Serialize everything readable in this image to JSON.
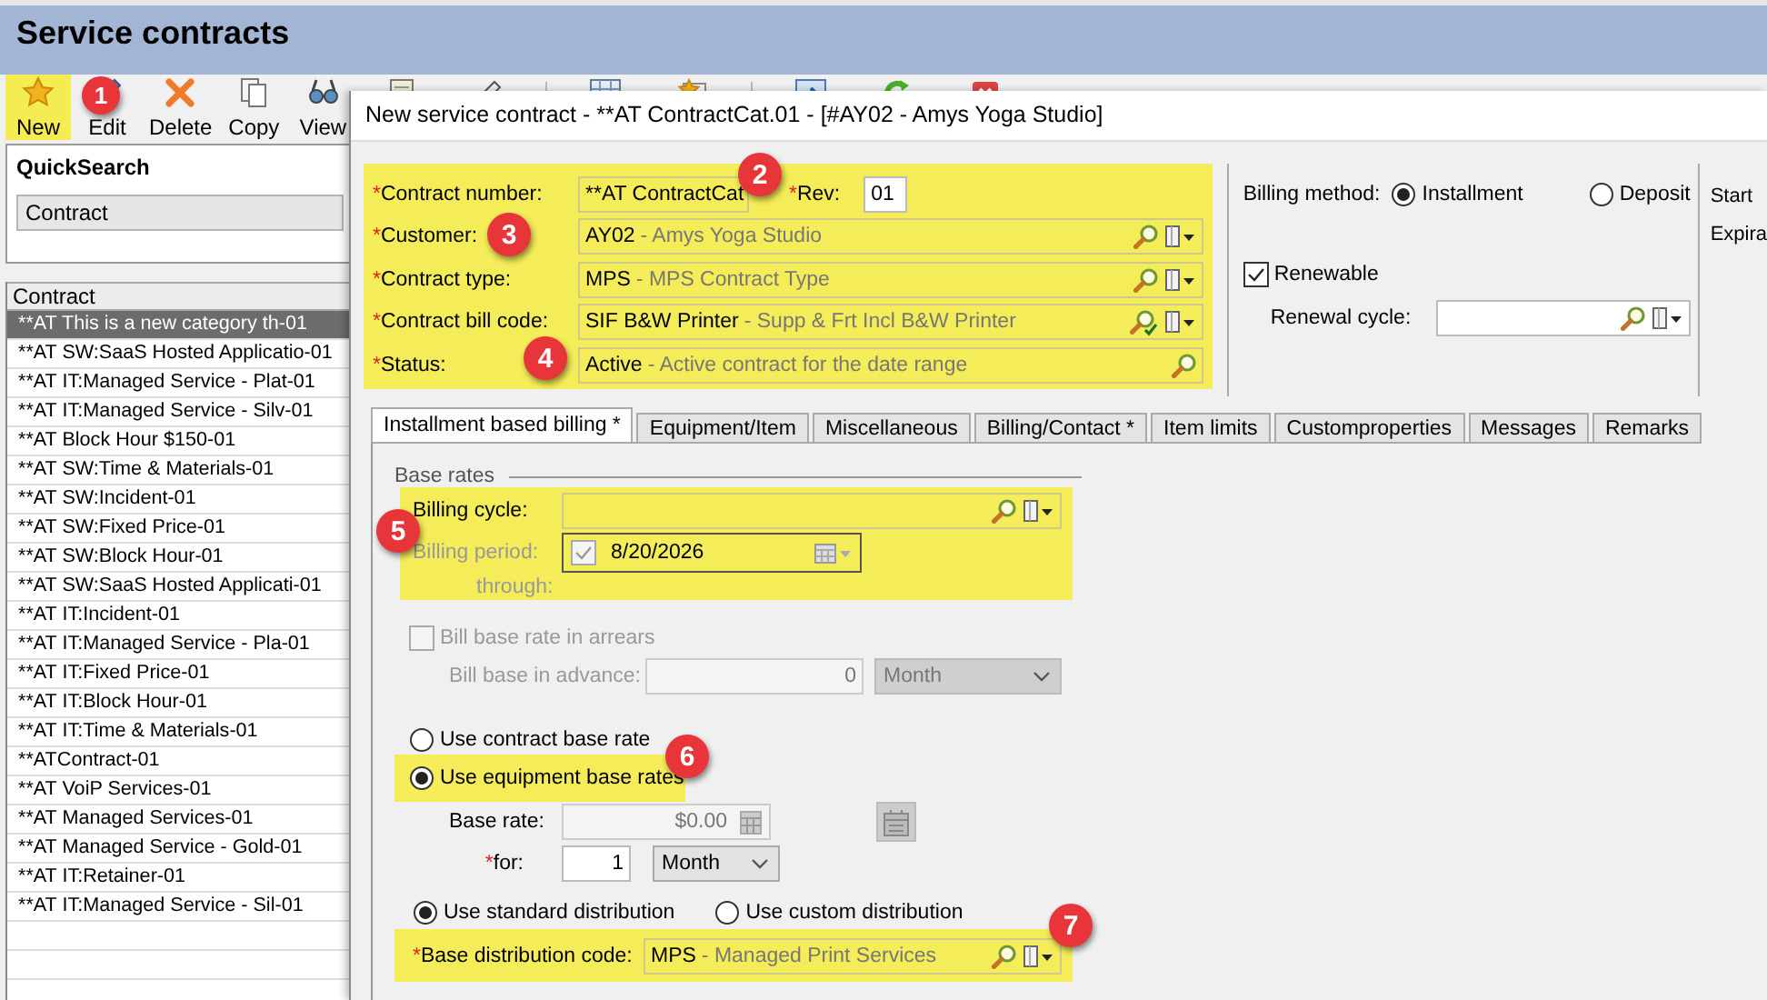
{
  "window": {
    "title": "Service contracts"
  },
  "toolbar": [
    {
      "label": "New",
      "highlighted": true,
      "kind": "star"
    },
    {
      "label": "Edit",
      "highlighted": false,
      "kind": "pencil"
    },
    {
      "label": "Delete",
      "highlighted": false,
      "kind": "delete"
    },
    {
      "label": "Copy",
      "highlighted": false,
      "kind": "copy"
    },
    {
      "label": "View",
      "highlighted": false,
      "kind": "view"
    }
  ],
  "quick_search": {
    "title": "QuickSearch",
    "field": "Contract"
  },
  "contract_list": {
    "column": "Contract",
    "rows": [
      {
        "label": "**AT This is a new category th-01",
        "selected": true
      },
      {
        "label": "**AT SW:SaaS Hosted Applicatio-01",
        "selected": false
      },
      {
        "label": "**AT IT:Managed Service - Plat-01",
        "selected": false
      },
      {
        "label": "**AT IT:Managed Service - Silv-01",
        "selected": false
      },
      {
        "label": "**AT Block Hour $150-01",
        "selected": false
      },
      {
        "label": "**AT SW:Time & Materials-01",
        "selected": false
      },
      {
        "label": "**AT SW:Incident-01",
        "selected": false
      },
      {
        "label": "**AT SW:Fixed Price-01",
        "selected": false
      },
      {
        "label": "**AT SW:Block Hour-01",
        "selected": false
      },
      {
        "label": "**AT SW:SaaS Hosted Applicati-01",
        "selected": false
      },
      {
        "label": "**AT IT:Incident-01",
        "selected": false
      },
      {
        "label": "**AT IT:Managed Service - Pla-01",
        "selected": false
      },
      {
        "label": "**AT IT:Fixed Price-01",
        "selected": false
      },
      {
        "label": "**AT IT:Block Hour-01",
        "selected": false
      },
      {
        "label": "**AT IT:Time & Materials-01",
        "selected": false
      },
      {
        "label": "**ATContract-01",
        "selected": false
      },
      {
        "label": "**AT VoiP Services-01",
        "selected": false
      },
      {
        "label": "**AT Managed Services-01",
        "selected": false
      },
      {
        "label": "**AT Managed Service - Gold-01",
        "selected": false
      },
      {
        "label": "**AT IT:Retainer-01",
        "selected": false
      },
      {
        "label": "**AT IT:Managed Service - Sil-01",
        "selected": false
      }
    ]
  },
  "dialog": {
    "title": "New service contract - **AT ContractCat.01 - [#AY02 - Amys Yoga Studio]",
    "header": {
      "highlighted": true,
      "contract_number": {
        "mark": "*",
        "label": "Contract number:",
        "value": "**AT ContractCat"
      },
      "rev": {
        "mark": "*",
        "label": "Rev:",
        "value": "01"
      },
      "lookups": [
        {
          "mark": "*",
          "label": "Customer:",
          "code": "AY02",
          "description": "- Amys Yoga Studio",
          "kind": "lookup"
        },
        {
          "mark": "*",
          "label": "Contract type:",
          "code": "MPS",
          "description": "- MPS Contract Type",
          "kind": "lookup"
        },
        {
          "mark": "*",
          "label": "Contract bill code:",
          "code": "SIF B&W Printer",
          "description": "- Supp & Frt Incl B&W Printer",
          "kind": "validated"
        },
        {
          "mark": "*",
          "label": "Status:",
          "code": "Active",
          "description": "- Active contract for the date range",
          "kind": "search"
        }
      ]
    },
    "billing_method": {
      "label": "Billing method:",
      "options": [
        {
          "label": "Installment",
          "selected": true
        },
        {
          "label": "Deposit",
          "selected": false
        }
      ]
    },
    "renewable": {
      "label": "Renewable",
      "checked": true
    },
    "renewal_cycle": {
      "label": "Renewal cycle:"
    },
    "date_labels": [
      "Start",
      "Expira"
    ],
    "tabs": [
      {
        "label": "Installment based billing *",
        "selected": true
      },
      {
        "label": "Equipment/Item",
        "selected": false
      },
      {
        "label": "Miscellaneous",
        "selected": false
      },
      {
        "label": "Billing/Contact *",
        "selected": false
      },
      {
        "label": "Item limits",
        "selected": false
      },
      {
        "label": "Customproperties",
        "selected": false
      },
      {
        "label": "Messages",
        "selected": false
      },
      {
        "label": "Remarks",
        "selected": false
      }
    ],
    "base_rates": {
      "title": "Base rates",
      "highlighted": true,
      "billing_cycle": {
        "label": "Billing cycle:"
      },
      "billing_period": {
        "label": "Billing period:",
        "disabled": true,
        "checked": true,
        "value": "8/20/2026"
      },
      "through": {
        "label": "through:"
      },
      "arrears": {
        "label": "Bill base rate in arrears",
        "checked": false,
        "disabled": true
      },
      "advance": {
        "label": "Bill base in advance:",
        "value": "0",
        "unit": "Month",
        "disabled": true
      },
      "rate_source": [
        {
          "label": "Use contract base rate",
          "selected": false,
          "highlighted": false
        },
        {
          "label": "Use equipment base rates",
          "selected": true,
          "highlighted": true
        }
      ],
      "base_rate": {
        "label": "Base rate:",
        "value": "$0.00",
        "disabled": true
      },
      "period": {
        "mark": "*",
        "label": "for:",
        "value": "1",
        "unit": "Month",
        "disabled": false
      },
      "distribution": [
        {
          "label": "Use standard distribution",
          "selected": true
        },
        {
          "label": "Use custom distribution",
          "selected": false
        }
      ],
      "distribution_code": {
        "highlighted": true,
        "mark": "*",
        "label": "Base distribution code:",
        "code": "MPS",
        "description": "- Managed Print Services"
      }
    }
  },
  "callouts": [
    "1",
    "2",
    "3",
    "4",
    "5",
    "6",
    "7"
  ]
}
